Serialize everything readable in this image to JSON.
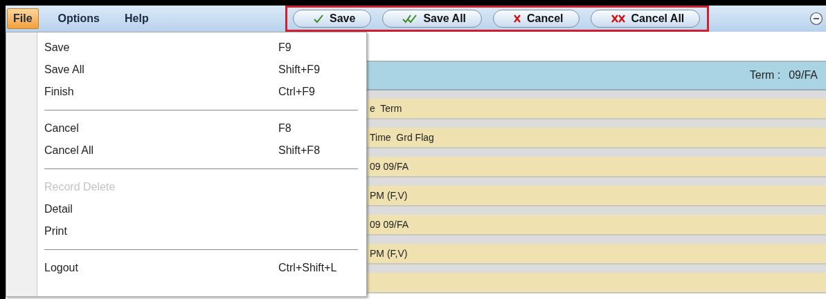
{
  "menubar": [
    {
      "label": "File",
      "selected": true
    },
    {
      "label": "Options",
      "selected": false
    },
    {
      "label": "Help",
      "selected": false
    }
  ],
  "toolbar": [
    {
      "label": "Save",
      "kind": "check"
    },
    {
      "label": "Save All",
      "kind": "double-check"
    },
    {
      "label": "Cancel",
      "kind": "cross"
    },
    {
      "label": "Cancel All",
      "kind": "double-cross"
    }
  ],
  "file_menu": [
    {
      "kind": "item",
      "label": "Save",
      "shortcut": "F9",
      "disabled": false
    },
    {
      "kind": "item",
      "label": "Save All",
      "shortcut": "Shift+F9",
      "disabled": false
    },
    {
      "kind": "item",
      "label": "Finish",
      "shortcut": "Ctrl+F9",
      "disabled": false
    },
    {
      "kind": "separator"
    },
    {
      "kind": "item",
      "label": "Cancel",
      "shortcut": "F8",
      "disabled": false
    },
    {
      "kind": "item",
      "label": "Cancel All",
      "shortcut": "Shift+F8",
      "disabled": false
    },
    {
      "kind": "separator"
    },
    {
      "kind": "item",
      "label": "Record Delete",
      "disabled": true
    },
    {
      "kind": "item",
      "label": "Detail",
      "disabled": false
    },
    {
      "kind": "item",
      "label": "Print",
      "disabled": false
    },
    {
      "kind": "separator"
    },
    {
      "kind": "item",
      "label": "Logout",
      "shortcut": "Ctrl+Shift+L",
      "disabled": false
    }
  ],
  "header": {
    "term_label": "Term :",
    "term_value": "09/FA"
  },
  "rows": [
    "e  Term",
    "Time  Grd Flag",
    "09 09/FA",
    "PM (F,V)",
    "09 09/FA",
    "PM (F,V)",
    ""
  ]
}
